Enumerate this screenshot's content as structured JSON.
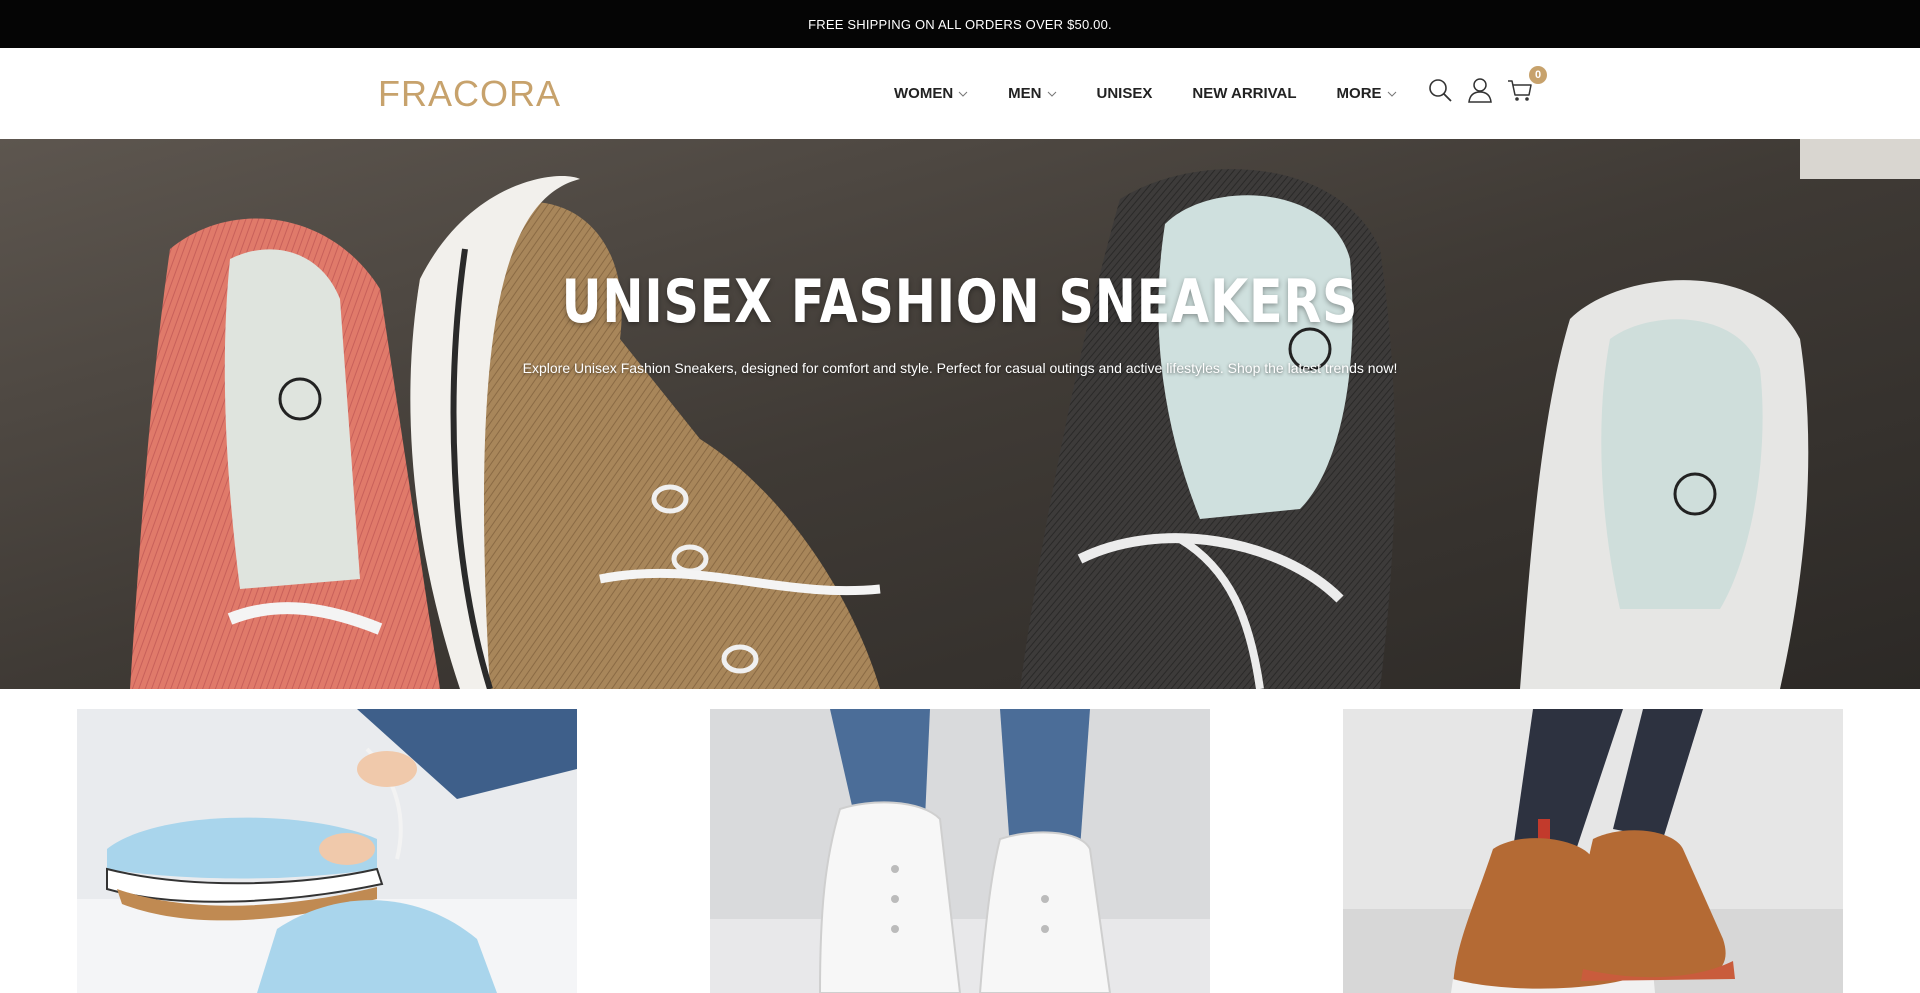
{
  "announcement": {
    "text": "FREE SHIPPING ON ALL ORDERS OVER $50.00."
  },
  "header": {
    "logo": "FRACORA",
    "nav": [
      {
        "label": "WOMEN",
        "has_dropdown": true
      },
      {
        "label": "MEN",
        "has_dropdown": true
      },
      {
        "label": "UNISEX",
        "has_dropdown": false
      },
      {
        "label": "NEW ARRIVAL",
        "has_dropdown": false
      },
      {
        "label": "MORE",
        "has_dropdown": true
      }
    ],
    "icons": [
      "search-icon",
      "account-icon",
      "cart-icon"
    ],
    "cart_count": "0"
  },
  "hero": {
    "title": "UNISEX FASHION SNEAKERS",
    "subtitle": "Explore Unisex Fashion Sneakers, designed for comfort and style. Perfect for casual outings and active lifestyles. Shop the latest trends now!"
  },
  "products": [
    {
      "image": "light-blue-canvas-sneakers-photo"
    },
    {
      "image": "white-high-top-sneakers-photo"
    },
    {
      "image": "brown-lace-up-boots-photo"
    }
  ],
  "colors": {
    "brand": "#c7a26c",
    "announcement_bg": "#050505",
    "text": "#222222"
  }
}
